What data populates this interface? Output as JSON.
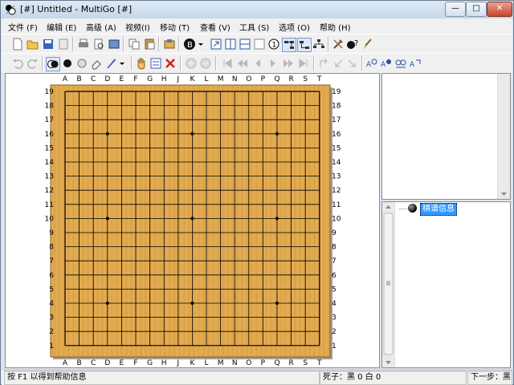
{
  "window": {
    "title": "[#] Untitled - MultiGo [#]",
    "minimize": "—",
    "maximize": "□",
    "close": "✕"
  },
  "menu": [
    {
      "label": "文件 (F)"
    },
    {
      "label": "编辑 (E)"
    },
    {
      "label": "高级 (A)"
    },
    {
      "label": "视频(I)"
    },
    {
      "label": "移动 (T)"
    },
    {
      "label": "查看 (V)"
    },
    {
      "label": "工具 (S)"
    },
    {
      "label": "选项 (O)"
    },
    {
      "label": "帮助 (H)"
    }
  ],
  "toolbar1": [
    {
      "icon": "new-file-icon"
    },
    {
      "icon": "open-folder-icon"
    },
    {
      "icon": "save-icon"
    },
    {
      "icon": "save-as-icon"
    },
    {
      "icon": "print-icon"
    },
    {
      "icon": "print-preview-icon"
    },
    {
      "icon": "export-image-icon"
    },
    {
      "icon": "copy-icon"
    },
    {
      "icon": "paste-icon"
    },
    {
      "icon": "game-info-icon"
    },
    {
      "icon": "stone-b-icon"
    },
    {
      "icon": "dropdown-arrow-icon"
    },
    {
      "icon": "next-move-icon"
    },
    {
      "icon": "board-icon"
    },
    {
      "icon": "board-split-icon"
    },
    {
      "icon": "board-blank-icon"
    },
    {
      "icon": "stone-1-icon"
    },
    {
      "icon": "tree-view-icon"
    },
    {
      "icon": "tree-view-2-icon"
    },
    {
      "icon": "tree-view-3-icon"
    },
    {
      "icon": "tools-icon"
    },
    {
      "icon": "stone-question-icon"
    },
    {
      "icon": "brush-icon"
    }
  ],
  "toolbar2": [
    {
      "icon": "undo-icon"
    },
    {
      "icon": "redo-icon"
    },
    {
      "icon": "alternate-stones-icon"
    },
    {
      "icon": "black-stone-icon"
    },
    {
      "icon": "white-stone-icon"
    },
    {
      "icon": "eraser-icon"
    },
    {
      "icon": "pen-icon"
    },
    {
      "icon": "dropdown-arrow-icon"
    },
    {
      "icon": "hand-icon"
    },
    {
      "icon": "mark-icon"
    },
    {
      "icon": "delete-icon"
    },
    {
      "icon": "circle-add-icon"
    },
    {
      "icon": "circle-remove-icon"
    },
    {
      "icon": "first-move-icon"
    },
    {
      "icon": "back-10-icon"
    },
    {
      "icon": "back-icon"
    },
    {
      "icon": "forward-icon"
    },
    {
      "icon": "forward-10-icon"
    },
    {
      "icon": "last-move-icon"
    },
    {
      "icon": "variation-up-icon"
    },
    {
      "icon": "variation-left-icon"
    },
    {
      "icon": "variation-right-icon"
    },
    {
      "icon": "search-a-icon"
    },
    {
      "icon": "search-b-icon"
    },
    {
      "icon": "search-c-icon"
    },
    {
      "icon": "search-d-icon"
    }
  ],
  "board": {
    "size": 19,
    "columns": [
      "A",
      "B",
      "C",
      "D",
      "E",
      "F",
      "G",
      "H",
      "J",
      "K",
      "L",
      "M",
      "N",
      "O",
      "P",
      "Q",
      "R",
      "S",
      "T"
    ],
    "rows": [
      "19",
      "18",
      "17",
      "16",
      "15",
      "14",
      "13",
      "12",
      "11",
      "10",
      "9",
      "8",
      "7",
      "6",
      "5",
      "4",
      "3",
      "2",
      "1"
    ],
    "star_points": [
      "D16",
      "K16",
      "Q16",
      "D10",
      "K10",
      "Q10",
      "D4",
      "K4",
      "Q4"
    ],
    "wood_color": "#e0a84e",
    "line_color": "#000000"
  },
  "tree": {
    "node_label": "棋谱信息"
  },
  "status": {
    "hint": "按 F1 以得到帮助信息",
    "captures": "死子：黑 0 白 0",
    "next": "下一步：黑"
  }
}
